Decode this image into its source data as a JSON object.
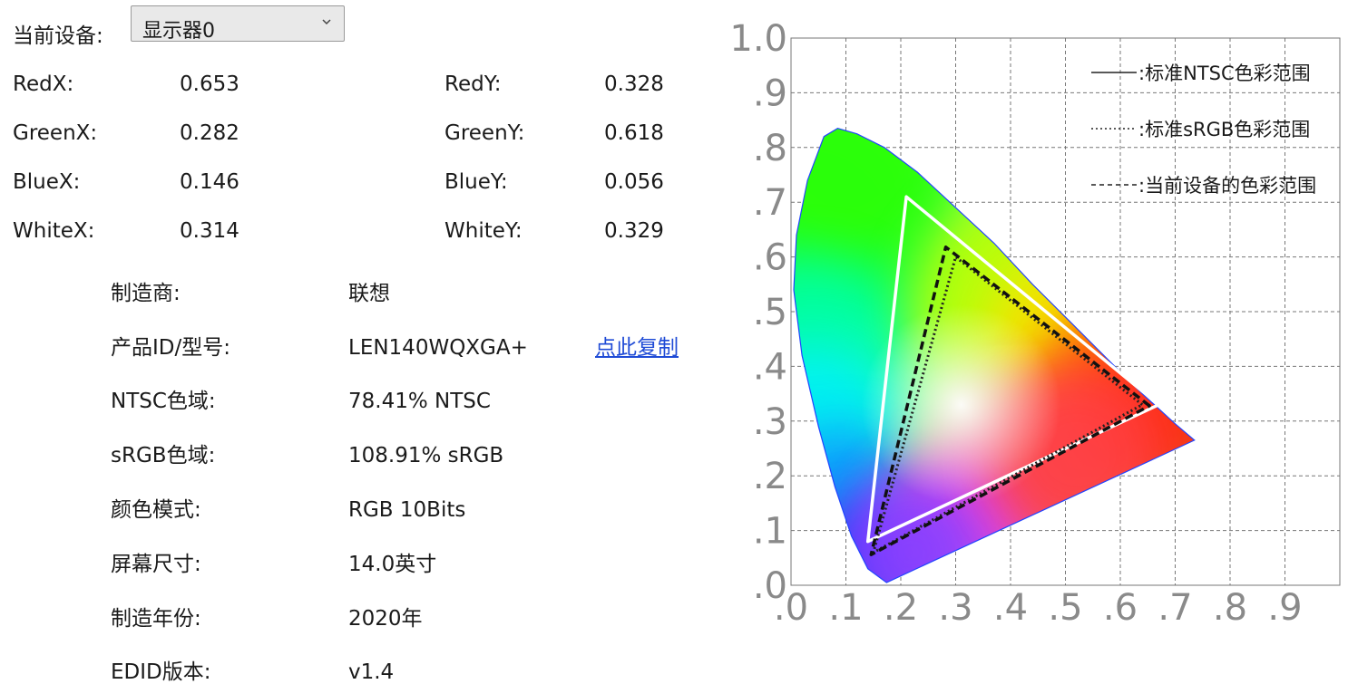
{
  "device": {
    "label": "当前设备:",
    "selected": "显示器0"
  },
  "coords": [
    {
      "xl": "RedX:",
      "xv": "0.653",
      "yl": "RedY:",
      "yv": "0.328"
    },
    {
      "xl": "GreenX:",
      "xv": "0.282",
      "yl": "GreenY:",
      "yv": "0.618"
    },
    {
      "xl": "BlueX:",
      "xv": "0.146",
      "yl": "BlueY:",
      "yv": "0.056"
    },
    {
      "xl": "WhiteX:",
      "xv": "0.314",
      "yl": "WhiteY:",
      "yv": "0.329"
    }
  ],
  "info": [
    {
      "label": "制造商:",
      "value": "联想"
    },
    {
      "label": "产品ID/型号:",
      "value": "LEN140WQXGA+"
    },
    {
      "label": "NTSC色域:",
      "value": "78.41% NTSC"
    },
    {
      "label": "sRGB色域:",
      "value": "108.91% sRGB"
    },
    {
      "label": "颜色模式:",
      "value": "RGB 10Bits"
    },
    {
      "label": "屏幕尺寸:",
      "value": "14.0英寸"
    },
    {
      "label": "制造年份:",
      "value": "2020年"
    },
    {
      "label": "EDID版本:",
      "value": "v1.4"
    }
  ],
  "copy_link": "点此复制",
  "chart_data": {
    "type": "scatter",
    "y_ticks": [
      ".0",
      ".1",
      ".2",
      ".3",
      ".4",
      ".5",
      ".6",
      ".7",
      ".8",
      ".9",
      "1.0"
    ],
    "x_ticks": [
      ".0",
      ".1",
      ".2",
      ".3",
      ".4",
      ".5",
      ".6",
      ".7",
      ".8",
      ".9"
    ],
    "xlim": [
      0,
      0.9
    ],
    "ylim": [
      0,
      1.0
    ],
    "grid": true,
    "legend": [
      {
        "style": "solid",
        "label": ":标准NTSC色彩范围"
      },
      {
        "style": "dotted",
        "label": ":标准sRGB色彩范围"
      },
      {
        "style": "dashed",
        "label": ":当前设备的色彩范围"
      }
    ],
    "series": [
      {
        "name": ":标准NTSC色彩范围",
        "points": [
          [
            0.67,
            0.33
          ],
          [
            0.21,
            0.71
          ],
          [
            0.14,
            0.08
          ]
        ]
      },
      {
        "name": ":标准sRGB色彩范围",
        "points": [
          [
            0.64,
            0.33
          ],
          [
            0.3,
            0.6
          ],
          [
            0.15,
            0.06
          ]
        ]
      },
      {
        "name": ":当前设备的色彩范围",
        "points": [
          [
            0.653,
            0.328
          ],
          [
            0.282,
            0.618
          ],
          [
            0.146,
            0.056
          ]
        ]
      }
    ]
  }
}
